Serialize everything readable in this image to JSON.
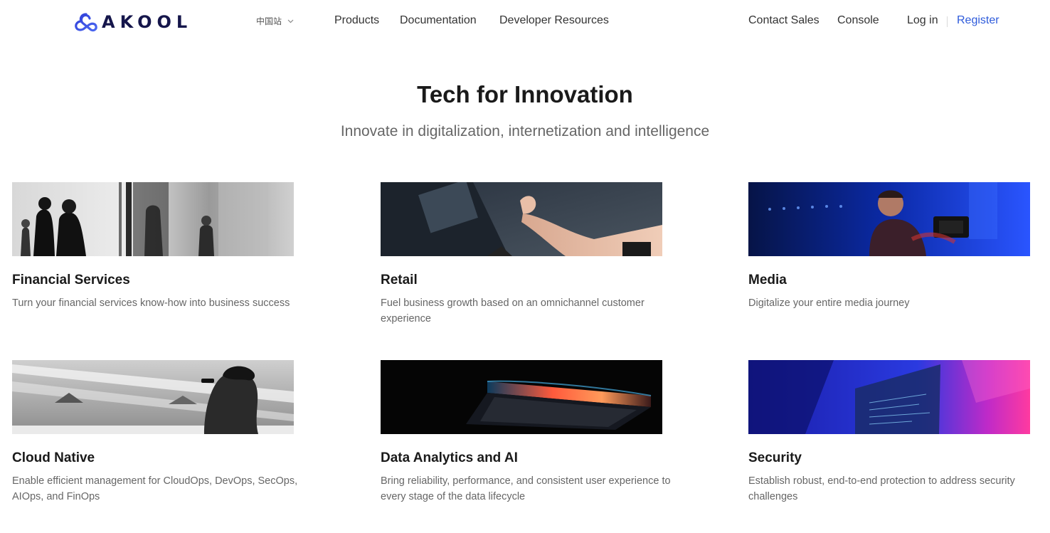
{
  "header": {
    "logo_text": "AKOOL",
    "region_label": "中国站",
    "nav": {
      "products": "Products",
      "documentation": "Documentation",
      "developer_resources": "Developer Resources",
      "contact_sales": "Contact Sales",
      "console": "Console",
      "login": "Log in",
      "register": "Register"
    }
  },
  "hero": {
    "title": "Tech for Innovation",
    "subtitle": "Innovate in digitalization, internetization and intelligence"
  },
  "cards": [
    {
      "title": "Financial Services",
      "description": "Turn your financial services know-how into business success"
    },
    {
      "title": "Retail",
      "description": "Fuel business growth based on an omnichannel customer experience"
    },
    {
      "title": "Media",
      "description": "Digitalize your entire media journey"
    },
    {
      "title": "Cloud Native",
      "description": "Enable efficient management for CloudOps, DevOps, SecOps, AIOps, and FinOps"
    },
    {
      "title": "Data Analytics and AI",
      "description": "Bring reliability, performance, and consistent user experience to every stage of the data lifecycle"
    },
    {
      "title": "Security",
      "description": "Establish robust, end-to-end protection to address security challenges"
    }
  ],
  "colors": {
    "brand": "#15164b",
    "logo_blue": "#3a4be0",
    "link_accent": "#2e5bdb"
  },
  "icons": {
    "logo": "akool-logo-mark",
    "region_toggle": "chevron-down-icon"
  }
}
